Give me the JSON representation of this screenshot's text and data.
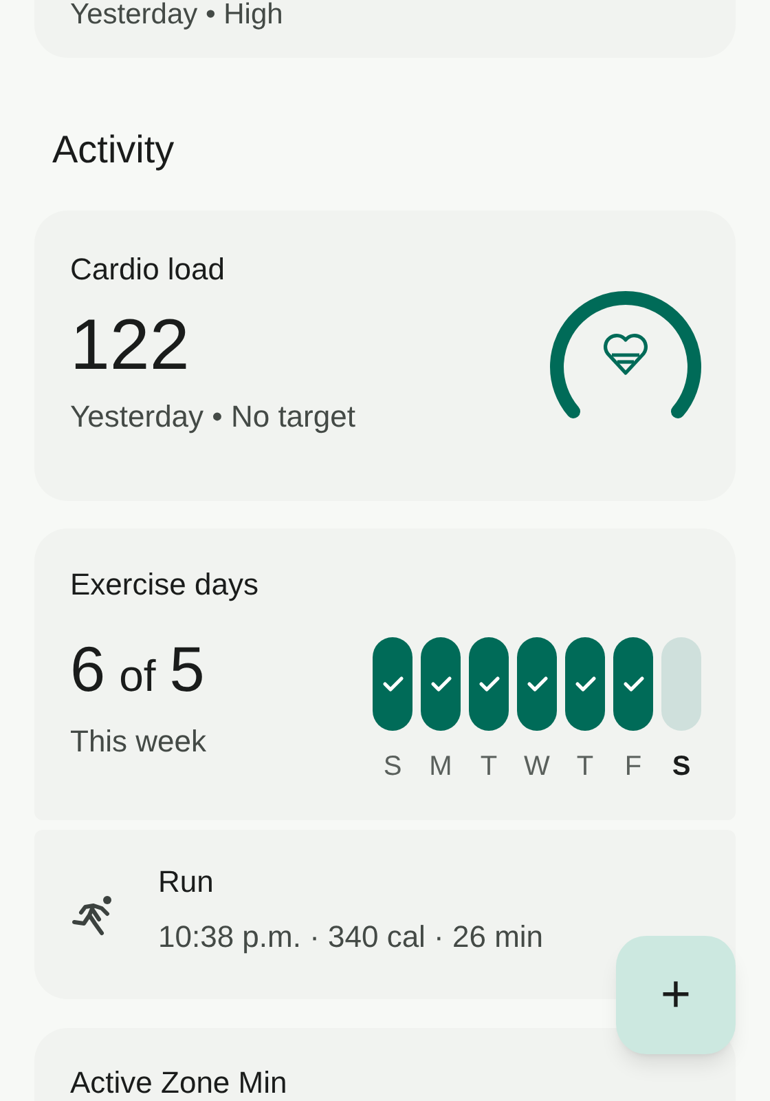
{
  "top_card": {
    "subtitle": "Yesterday • High"
  },
  "section_title": "Activity",
  "cardio": {
    "title": "Cardio load",
    "value": "122",
    "subtitle": "Yesterday • No target"
  },
  "exercise": {
    "title": "Exercise days",
    "count": "6",
    "of": "of",
    "target": "5",
    "subtitle": "This week",
    "days": [
      {
        "label": "S",
        "done": true,
        "today": false
      },
      {
        "label": "M",
        "done": true,
        "today": false
      },
      {
        "label": "T",
        "done": true,
        "today": false
      },
      {
        "label": "W",
        "done": true,
        "today": false
      },
      {
        "label": "T",
        "done": true,
        "today": false
      },
      {
        "label": "F",
        "done": true,
        "today": false
      },
      {
        "label": "S",
        "done": false,
        "today": true
      }
    ]
  },
  "activities": [
    {
      "kind": "run",
      "title": "Run",
      "details": "10:38 p.m. · 340 cal · 26 min"
    }
  ],
  "next_card": {
    "title": "Active Zone Min"
  },
  "fab": {
    "label": "+"
  }
}
